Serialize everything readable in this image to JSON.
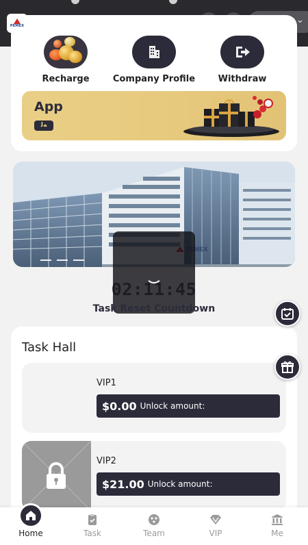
{
  "header": {
    "logo_text": "PEMEX",
    "language_chevron": "chevron-down-icon"
  },
  "actions": [
    {
      "label": "Recharge",
      "icon": "coins-icon"
    },
    {
      "label": "Company Profile",
      "icon": "building-icon"
    },
    {
      "label": "Withdraw",
      "icon": "withdraw-icon"
    }
  ],
  "app_banner": {
    "title": "App",
    "chip": "ﻪﻟ"
  },
  "hero": {
    "building_sign": "PEMEX"
  },
  "countdown": {
    "time": "02:11:45",
    "label": "Task Reset Countdown"
  },
  "task_hall": {
    "title": "Task Hall",
    "cards": [
      {
        "name": "VIP1",
        "amount": "$0.00",
        "amount_label": "Unlock amount:",
        "locked": false
      },
      {
        "name": "VIP2",
        "amount": "$21.00",
        "amount_label": "Unlock amount:",
        "locked": true
      }
    ]
  },
  "nav": [
    {
      "label": "Home",
      "icon": "home-icon",
      "active": true
    },
    {
      "label": "Task",
      "icon": "clipboard-icon",
      "active": false
    },
    {
      "label": "Team",
      "icon": "team-icon",
      "active": false
    },
    {
      "label": "VIP",
      "icon": "diamond-icon",
      "active": false
    },
    {
      "label": "Me",
      "icon": "bank-icon",
      "active": false
    }
  ],
  "colors": {
    "primary": "#2b2b3a",
    "gold": "#e9cf86",
    "background": "#f2f2f2"
  }
}
